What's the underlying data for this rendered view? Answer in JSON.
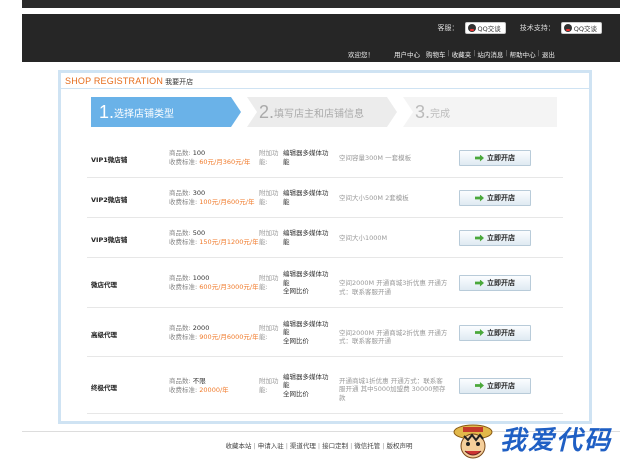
{
  "header": {
    "support_label": "客服：",
    "tech_label": "技术支持：",
    "qq_label": "QQ交谈",
    "nav": [
      "欢迎您！",
      "用户中心",
      "购物车",
      "收藏夹",
      "站内消息",
      "帮助中心",
      "退出"
    ]
  },
  "card": {
    "title_en": "SHOP REGISTRATION",
    "title_zh": "我要开店"
  },
  "steps": [
    {
      "num": "1.",
      "label": "选择店铺类型"
    },
    {
      "num": "2.",
      "label": "填写店主和店铺信息"
    },
    {
      "num": "3.",
      "label": "完成"
    }
  ],
  "labels": {
    "qty": "商品数:",
    "fee": "收费标准:",
    "addl": "附加功能:",
    "open": "立即开店"
  },
  "rows": [
    {
      "name": "VIP1微店铺",
      "qty": "100",
      "fee": "60元/月360元/年",
      "func": "编辑器多媒体功能",
      "extra": "",
      "desc": "空间容量300M 一套模板"
    },
    {
      "name": "VIP2微店铺",
      "qty": "300",
      "fee": "100元/月600元/年",
      "func": "编辑器多媒体功能",
      "extra": "",
      "desc": "空间大小500M 2套模板"
    },
    {
      "name": "VIP3微店铺",
      "qty": "500",
      "fee": "150元/月1200元/年",
      "func": "编辑器多媒体功能",
      "extra": "",
      "desc": "空间大小1000M"
    },
    {
      "name": "微店代理",
      "qty": "1000",
      "fee": "600元/月3000元/年",
      "func": "编辑器多媒体功能",
      "extra": "全网比价",
      "desc": "空间2000M 开通商城3折优惠 开通方式：联系客服开通"
    },
    {
      "name": "高级代理",
      "qty": "2000",
      "fee": "900元/月6000元/年",
      "func": "编辑器多媒体功能",
      "extra": "全网比价",
      "desc": "空间2000M 开通商城2折优惠 开通方式：联系客服开通"
    },
    {
      "name": "终极代理",
      "qty": "不限",
      "fee": "20000/年",
      "func": "编辑器多媒体功能",
      "extra": "全网比价",
      "desc": "开通商城1折优惠 开通方式：联系客服开通 其中5000加盟费 30000预存款"
    }
  ],
  "footer": [
    "收藏本站",
    "申请入驻",
    "渠道代理",
    "接口定制",
    "微信托管",
    "版权声明"
  ],
  "watermark": "我爱代码"
}
